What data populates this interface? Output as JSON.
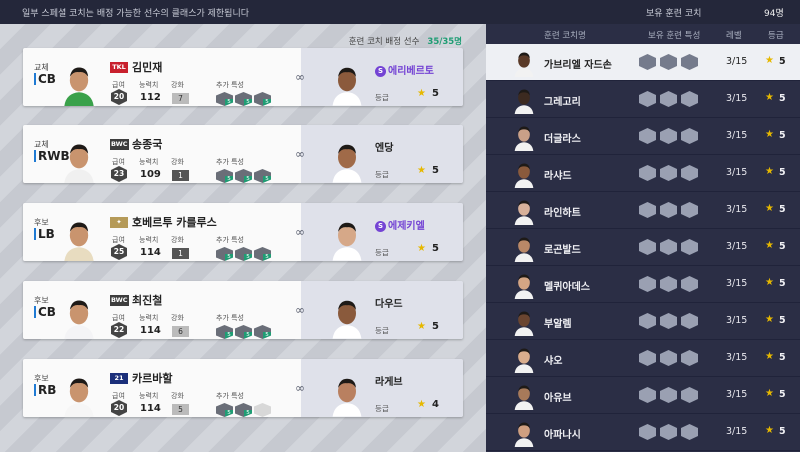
{
  "topbar": {
    "notice": "일부 스페셜 코치는 배정 가능한 선수의 클래스가 제한됩니다",
    "owned_label": "보유 훈련 코치",
    "owned_count": "94명"
  },
  "assignment": {
    "header_label": "훈련 코치 배정 선수",
    "header_count": "35/35명",
    "labels": {
      "salary": "급여",
      "ability": "능력치",
      "enhance": "강화",
      "traits": "추가 특성",
      "grade": "등급"
    },
    "cards": [
      {
        "role": "교체",
        "position": "CB",
        "badge": "TKL",
        "badge_color": "#c8202d",
        "name": "김민재",
        "salary": "20",
        "ability": "112",
        "enhance": "7",
        "enhance_style": "light",
        "traits": [
          "tactics-icon",
          "header-icon",
          "mark-icon"
        ],
        "coach_name": "에리베르토",
        "coach_special": true,
        "grade": "5"
      },
      {
        "role": "교체",
        "position": "RWB",
        "badge": "BWC",
        "badge_color": "#3d3d3d",
        "name": "송종국",
        "salary": "23",
        "ability": "109",
        "enhance": "1",
        "enhance_style": "dark",
        "traits": [
          "tactics-icon",
          "ball-icon",
          "shield-icon"
        ],
        "coach_name": "엔당",
        "coach_special": false,
        "grade": "5"
      },
      {
        "role": "후보",
        "position": "LB",
        "badge": "✦",
        "badge_color": "#b59a58",
        "name": "호베르투 카를루스",
        "salary": "25",
        "ability": "114",
        "enhance": "1",
        "enhance_style": "dark",
        "traits": [
          "speed-icon",
          "tactics-icon",
          "run-icon"
        ],
        "coach_name": "에제키엘",
        "coach_special": true,
        "grade": "5"
      },
      {
        "role": "후보",
        "position": "CB",
        "badge": "BWC",
        "badge_color": "#3d3d3d",
        "name": "최진철",
        "salary": "22",
        "ability": "114",
        "enhance": "6",
        "enhance_style": "light",
        "traits": [
          "tactics-icon",
          "header-icon",
          "shield-icon"
        ],
        "coach_name": "다우드",
        "coach_special": false,
        "grade": "5"
      },
      {
        "role": "후보",
        "position": "RB",
        "badge": "21",
        "badge_color": "#1b2f7a",
        "name": "카르바할",
        "salary": "20",
        "ability": "114",
        "enhance": "5",
        "enhance_style": "light",
        "traits": [
          "tactics-icon",
          "shield-icon",
          "empty-slot-icon"
        ],
        "coach_name": "라게브",
        "coach_special": false,
        "grade": "4"
      }
    ]
  },
  "coach_list": {
    "columns": {
      "name": "훈련 코치명",
      "traits": "보유 훈련 특성",
      "level": "레벨",
      "grade": "등급"
    },
    "rows": [
      {
        "name": "가브리엘 자드손",
        "level": "3/15",
        "grade": "5",
        "skin": "#5a3a28"
      },
      {
        "name": "그레고리",
        "level": "3/15",
        "grade": "5",
        "skin": "#3c2a20"
      },
      {
        "name": "더글라스",
        "level": "3/15",
        "grade": "5",
        "skin": "#c9a088"
      },
      {
        "name": "라샤드",
        "level": "3/15",
        "grade": "5",
        "skin": "#8a5a3c"
      },
      {
        "name": "라인하트",
        "level": "3/15",
        "grade": "5",
        "skin": "#d8b19a"
      },
      {
        "name": "로곤발드",
        "level": "3/15",
        "grade": "5",
        "skin": "#b98867"
      },
      {
        "name": "멜퀴아데스",
        "level": "3/15",
        "grade": "5",
        "skin": "#d4a584"
      },
      {
        "name": "부알렘",
        "level": "3/15",
        "grade": "5",
        "skin": "#6a4530"
      },
      {
        "name": "샤오",
        "level": "3/15",
        "grade": "5",
        "skin": "#d9ad8c"
      },
      {
        "name": "아유브",
        "level": "3/15",
        "grade": "5",
        "skin": "#a77a5a"
      },
      {
        "name": "아파나시",
        "level": "3/15",
        "grade": "5",
        "skin": "#cf9f80"
      }
    ]
  }
}
